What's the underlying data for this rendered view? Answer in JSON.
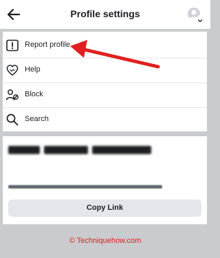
{
  "header": {
    "title": "Profile settings"
  },
  "menu": {
    "items": [
      {
        "label": "Report profile",
        "icon": "report-icon"
      },
      {
        "label": "Help",
        "icon": "help-heart-icon"
      },
      {
        "label": "Block",
        "icon": "block-user-icon"
      },
      {
        "label": "Search",
        "icon": "search-icon"
      }
    ]
  },
  "share": {
    "copy_label": "Copy Link"
  },
  "watermark": {
    "text": "© Techniquehow.com"
  },
  "colors": {
    "accent": "#e02020",
    "background": "#c9cbce",
    "button": "#e4e6eb"
  }
}
